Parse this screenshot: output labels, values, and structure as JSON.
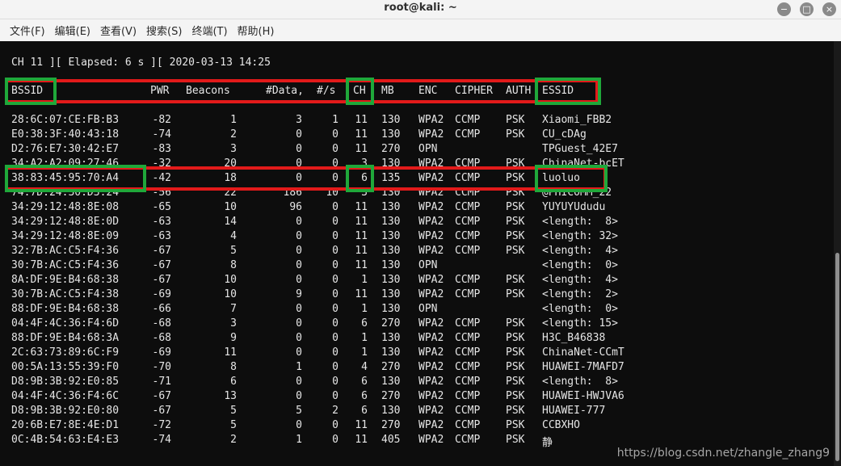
{
  "window": {
    "title": "root@kali: ~",
    "controls": [
      "−",
      "□",
      "×"
    ]
  },
  "menu": [
    "文件(F)",
    "编辑(E)",
    "查看(V)",
    "搜索(S)",
    "终端(T)",
    "帮助(H)"
  ],
  "terminal": {
    "status": "CH 11 ][ Elapsed: 6 s ][ 2020-03-13 14:25",
    "headers": [
      "BSSID",
      "PWR",
      "Beacons",
      "#Data,",
      "#/s",
      "CH",
      "MB",
      "ENC",
      "CIPHER",
      "AUTH",
      "ESSID"
    ],
    "rows": [
      [
        "28:6C:07:CE:FB:B3",
        "-82",
        "1",
        "3",
        "1",
        "11",
        "130",
        "WPA2",
        "CCMP",
        "PSK",
        "Xiaomi_FBB2"
      ],
      [
        "E0:38:3F:40:43:18",
        "-74",
        "2",
        "0",
        "0",
        "11",
        "130",
        "WPA2",
        "CCMP",
        "PSK",
        "CU_cDAg"
      ],
      [
        "D2:76:E7:30:42:E7",
        "-83",
        "3",
        "0",
        "0",
        "11",
        "270",
        "OPN",
        "",
        "",
        "TPGuest_42E7"
      ],
      [
        "34:A2:A2:09:27:46",
        "-32",
        "20",
        "0",
        "0",
        "3",
        "130",
        "WPA2",
        "CCMP",
        "PSK",
        "ChinaNet-bcET"
      ],
      [
        "38:83:45:95:70:A4",
        "-42",
        "18",
        "0",
        "0",
        "6",
        "135",
        "WPA2",
        "CCMP",
        "PSK",
        "luoluo"
      ],
      [
        "74:7D:24:30:D3:24",
        "-56",
        "22",
        "186",
        "10",
        "3",
        "130",
        "WPA2",
        "CCMP",
        "PSK",
        "@PHICOMM_22"
      ],
      [
        "34:29:12:48:8E:08",
        "-65",
        "10",
        "96",
        "0",
        "11",
        "130",
        "WPA2",
        "CCMP",
        "PSK",
        "YUYUYUdudu"
      ],
      [
        "34:29:12:48:8E:0D",
        "-63",
        "14",
        "0",
        "0",
        "11",
        "130",
        "WPA2",
        "CCMP",
        "PSK",
        "<length:  8>"
      ],
      [
        "34:29:12:48:8E:09",
        "-63",
        "4",
        "0",
        "0",
        "11",
        "130",
        "WPA2",
        "CCMP",
        "PSK",
        "<length: 32>"
      ],
      [
        "32:7B:AC:C5:F4:36",
        "-67",
        "5",
        "0",
        "0",
        "11",
        "130",
        "WPA2",
        "CCMP",
        "PSK",
        "<length:  4>"
      ],
      [
        "30:7B:AC:C5:F4:36",
        "-67",
        "8",
        "0",
        "0",
        "11",
        "130",
        "OPN",
        "",
        "",
        "<length:  0>"
      ],
      [
        "8A:DF:9E:B4:68:38",
        "-67",
        "10",
        "0",
        "0",
        "1",
        "130",
        "WPA2",
        "CCMP",
        "PSK",
        "<length:  4>"
      ],
      [
        "30:7B:AC:C5:F4:38",
        "-69",
        "10",
        "9",
        "0",
        "11",
        "130",
        "WPA2",
        "CCMP",
        "PSK",
        "<length:  2>"
      ],
      [
        "88:DF:9E:B4:68:38",
        "-66",
        "7",
        "0",
        "0",
        "1",
        "130",
        "OPN",
        "",
        "",
        "<length:  0>"
      ],
      [
        "04:4F:4C:36:F4:6D",
        "-68",
        "3",
        "0",
        "0",
        "6",
        "270",
        "WPA2",
        "CCMP",
        "PSK",
        "<length: 15>"
      ],
      [
        "88:DF:9E:B4:68:3A",
        "-68",
        "9",
        "0",
        "0",
        "1",
        "130",
        "WPA2",
        "CCMP",
        "PSK",
        "H3C_B46838"
      ],
      [
        "2C:63:73:89:6C:F9",
        "-69",
        "11",
        "0",
        "0",
        "1",
        "130",
        "WPA2",
        "CCMP",
        "PSK",
        "ChinaNet-CCmT"
      ],
      [
        "00:5A:13:55:39:F0",
        "-70",
        "8",
        "1",
        "0",
        "4",
        "270",
        "WPA2",
        "CCMP",
        "PSK",
        "HUAWEI-7MAFD7"
      ],
      [
        "D8:9B:3B:92:E0:85",
        "-71",
        "6",
        "0",
        "0",
        "6",
        "130",
        "WPA2",
        "CCMP",
        "PSK",
        "<length:  8>"
      ],
      [
        "04:4F:4C:36:F4:6C",
        "-67",
        "13",
        "0",
        "0",
        "6",
        "270",
        "WPA2",
        "CCMP",
        "PSK",
        "HUAWEI-HWJVA6"
      ],
      [
        "D8:9B:3B:92:E0:80",
        "-67",
        "5",
        "5",
        "2",
        "6",
        "130",
        "WPA2",
        "CCMP",
        "PSK",
        "HUAWEI-777"
      ],
      [
        "20:6B:E7:8E:4E:D1",
        "-72",
        "5",
        "0",
        "0",
        "11",
        "270",
        "WPA2",
        "CCMP",
        "PSK",
        "CCBXHO"
      ],
      [
        "0C:4B:54:63:E4:E3",
        "-74",
        "2",
        "1",
        "0",
        "11",
        "405",
        "WPA2",
        "CCMP",
        "PSK",
        "静"
      ]
    ]
  },
  "watermark": "https://blog.csdn.net/zhangle_zhang9",
  "colors": {
    "highlight_green": "#1fa83a",
    "highlight_red": "#e21a1a",
    "terminal_bg": "#0d0d0d",
    "terminal_fg": "#e6e6e6"
  }
}
